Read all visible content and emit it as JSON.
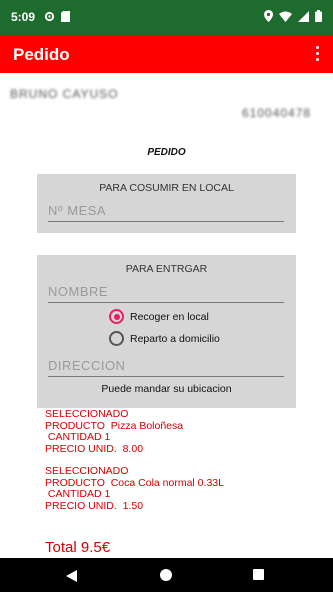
{
  "status_bar": {
    "time": "5:09",
    "icons_left": [
      "gear-icon",
      "sd-card-icon"
    ],
    "icons_right": [
      "location-icon",
      "wifi-icon",
      "signal-icon",
      "battery-icon"
    ]
  },
  "app_bar": {
    "title": "Pedido",
    "menu_icon": "overflow-menu-icon",
    "color": "#ff0000"
  },
  "customer": {
    "name_redacted": "BRUNO CAYUSO",
    "phone_redacted": "610040478"
  },
  "heading": "PEDIDO",
  "local_section": {
    "caption": "PARA COSUMIR EN LOCAL",
    "table_placeholder": "Nº MESA"
  },
  "delivery_section": {
    "caption": "PARA ENTRGAR",
    "name_placeholder": "NOMBRE",
    "option_pickup": "Recoger en local",
    "option_delivery": "Reparto a domicilio",
    "selected_option": "Recoger en local",
    "address_placeholder": "DIRECCION",
    "location_note": "Puede mandar su ubicacion"
  },
  "orders": [
    {
      "selected_label": "SELECCIONADO",
      "product_line": "PRODUCTO  Pizza Boloñesa",
      "quantity_line": " CANTIDAD 1",
      "price_line": "PRECIO UNID.  8.00"
    },
    {
      "selected_label": "SELECCIONADO",
      "product_line": "PRODUCTO  Coca Cola normal 0.33L",
      "quantity_line": " CANTIDAD 1",
      "price_line": "PRECIO UNID.  1.50"
    }
  ],
  "total": "Total 9.5€",
  "colors": {
    "status_bar": "#1e6b2e",
    "accent_red": "#ff0000",
    "order_text": "#d40000",
    "radio_selected": "#e91e63"
  },
  "nav_bar": {
    "icons": [
      "back-icon",
      "home-icon",
      "recents-icon"
    ]
  }
}
